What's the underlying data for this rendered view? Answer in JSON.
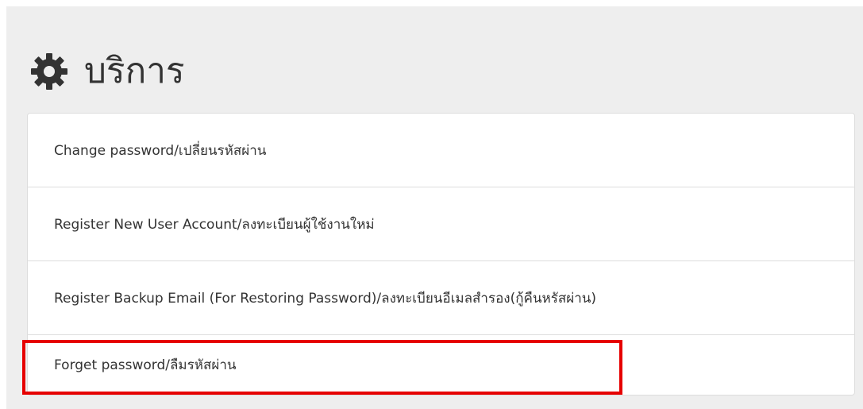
{
  "header": {
    "icon": "gear-icon",
    "title": "บริการ"
  },
  "services": {
    "items": [
      {
        "label": "Change password/เปลี่ยนรหัสผ่าน"
      },
      {
        "label": "Register New User Account/ลงทะเบียนผู้ใช้งานใหม่"
      },
      {
        "label": "Register Backup Email (For Restoring Password)/ลงทะเบียนอีเมลสำรอง(กู้คืนหรัสผ่าน)"
      },
      {
        "label": "Forget password/ลืมรหัสผ่าน"
      }
    ]
  },
  "colors": {
    "panel_background": "#eeeeee",
    "highlight_border": "#e60000",
    "text": "#333333"
  }
}
